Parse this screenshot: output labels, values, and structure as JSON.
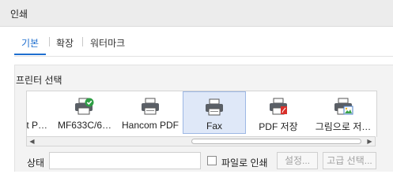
{
  "window": {
    "title": "인쇄"
  },
  "tabs": [
    {
      "label": "기본",
      "active": true
    },
    {
      "label": "확장",
      "active": false
    },
    {
      "label": "워터마크",
      "active": false
    }
  ],
  "printer_select": {
    "label": "프린터 선택",
    "items": [
      {
        "label": "t P…",
        "icon": "printer-icon"
      },
      {
        "label": "MF633C/6…",
        "icon": "printer-default-check-icon"
      },
      {
        "label": "Hancom PDF",
        "icon": "printer-icon"
      },
      {
        "label": "Fax",
        "icon": "printer-icon",
        "selected": true
      },
      {
        "label": "PDF 저장",
        "icon": "printer-pdf-icon"
      },
      {
        "label": "그림으로 저…",
        "icon": "printer-image-icon"
      }
    ]
  },
  "status": {
    "label": "상태",
    "value": ""
  },
  "print_to_file": {
    "label": "파일로 인쇄",
    "checked": false
  },
  "buttons": {
    "settings": "설정...",
    "advanced": "고급 선택..."
  },
  "colors": {
    "accent": "#1f6fcf",
    "selection": "#dfe8f8",
    "check_badge": "#2e9e44",
    "pdf_badge": "#d9302a"
  }
}
